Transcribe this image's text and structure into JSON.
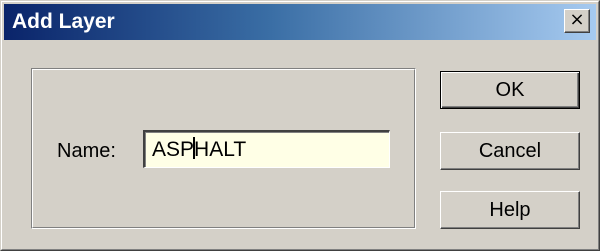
{
  "window": {
    "title": "Add Layer",
    "close_glyph": "×"
  },
  "form": {
    "name_label": "Name:",
    "name_value_before_caret": "ASP",
    "name_value_after_caret": "HALT"
  },
  "buttons": {
    "ok": "OK",
    "cancel": "Cancel",
    "help": "Help"
  },
  "colors": {
    "titlebar_start": "#0a246a",
    "titlebar_end": "#a6caf0",
    "dialog_face": "#d4d0c8",
    "input_bg": "#ffffe6"
  },
  "icons": {
    "close": "close-icon"
  }
}
